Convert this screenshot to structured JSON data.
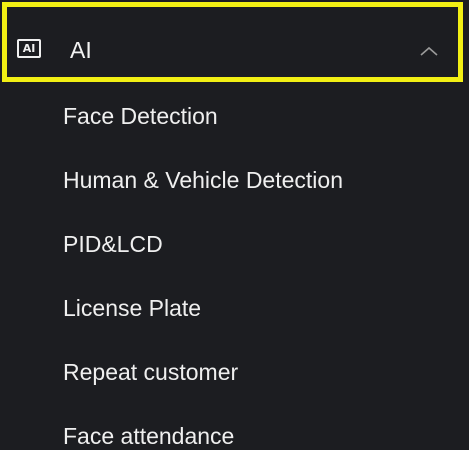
{
  "menu": {
    "header": {
      "icon": "ai-icon",
      "icon_text": "AI",
      "label": "AI",
      "expanded": true,
      "chevron_icon": "chevron-up-icon",
      "highlight_color": "#f2ef14"
    },
    "items": [
      {
        "label": "Face Detection"
      },
      {
        "label": "Human & Vehicle Detection"
      },
      {
        "label": "PID&LCD"
      },
      {
        "label": "License Plate"
      },
      {
        "label": "Repeat customer"
      },
      {
        "label": "Face attendance"
      }
    ]
  }
}
